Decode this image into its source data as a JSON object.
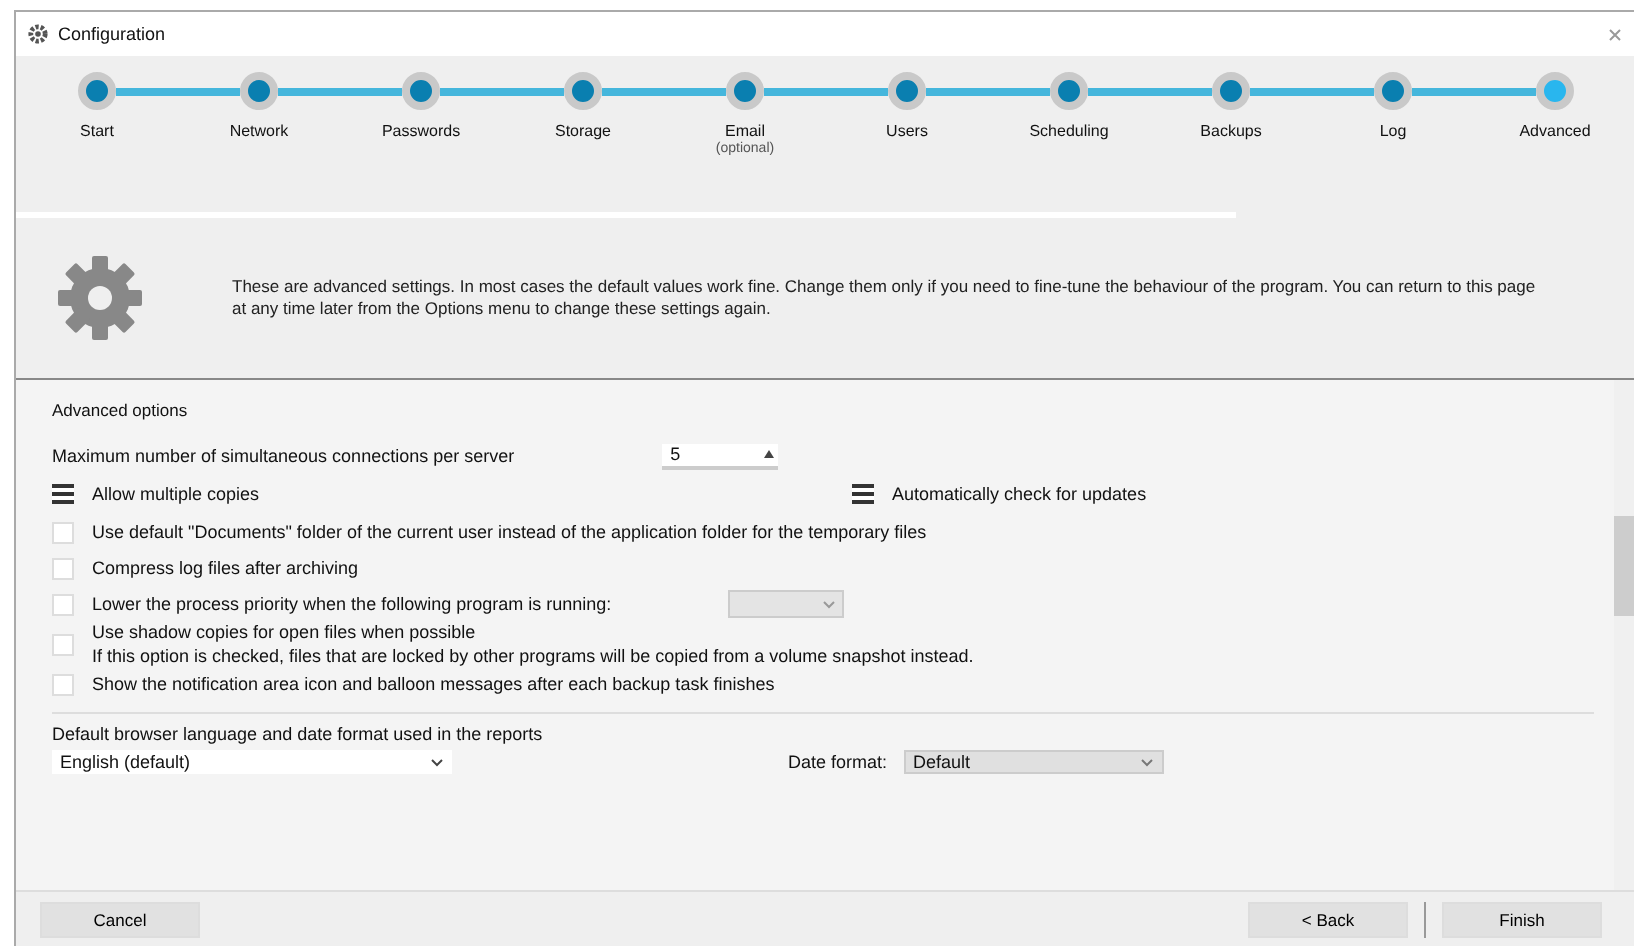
{
  "window": {
    "title": "Configuration"
  },
  "steps": [
    {
      "label": "Start",
      "selected": false
    },
    {
      "label": "Network",
      "selected": false
    },
    {
      "label": "Passwords",
      "selected": false
    },
    {
      "label": "Storage",
      "selected": false
    },
    {
      "label": "Email",
      "note": "(optional)",
      "selected": false
    },
    {
      "label": "Users",
      "selected": false
    },
    {
      "label": "Scheduling",
      "selected": false
    },
    {
      "label": "Backups",
      "selected": false
    },
    {
      "label": "Log",
      "selected": false
    },
    {
      "label": "Advanced",
      "selected": true
    }
  ],
  "header": {
    "description": "These are advanced settings. In most cases the default values work fine. Change them only if you need to fine-tune the behaviour of the program. You can return to this page at any time later from the Options menu to change these settings again."
  },
  "section_title": "Advanced options",
  "spinner": {
    "label": "Maximum number of simultaneous connections per server",
    "value": "5"
  },
  "pair": [
    {
      "label": "Allow multiple copies",
      "checked": true
    },
    {
      "label": "Automatically check for updates",
      "checked": true
    }
  ],
  "options": [
    {
      "kind": "check",
      "label": "Use default \"Documents\" folder of the current user instead of the application folder for the temporary files",
      "checked": false
    },
    {
      "kind": "check",
      "label": "Compress log files after archiving",
      "checked": false
    },
    {
      "kind": "dropdown",
      "label": "Lower the process priority when the following program is running:",
      "checked": false,
      "dropdown_disabled": true
    },
    {
      "kind": "two-line",
      "label": "Use shadow copies for open files when possible",
      "detail": "If this option is checked, files that are locked by other programs will be copied from a volume snapshot instead.",
      "checked": false
    },
    {
      "kind": "check",
      "label": "Show the notification area icon and balloon messages after each backup task finishes",
      "checked": false
    }
  ],
  "language": {
    "title": "Default browser language and date format used in the reports",
    "language_value": "English (default)",
    "date_label": "Date format:",
    "date_value": "Default"
  },
  "buttons": {
    "cancel": "Cancel",
    "back": "< Back",
    "next": "Finish"
  }
}
